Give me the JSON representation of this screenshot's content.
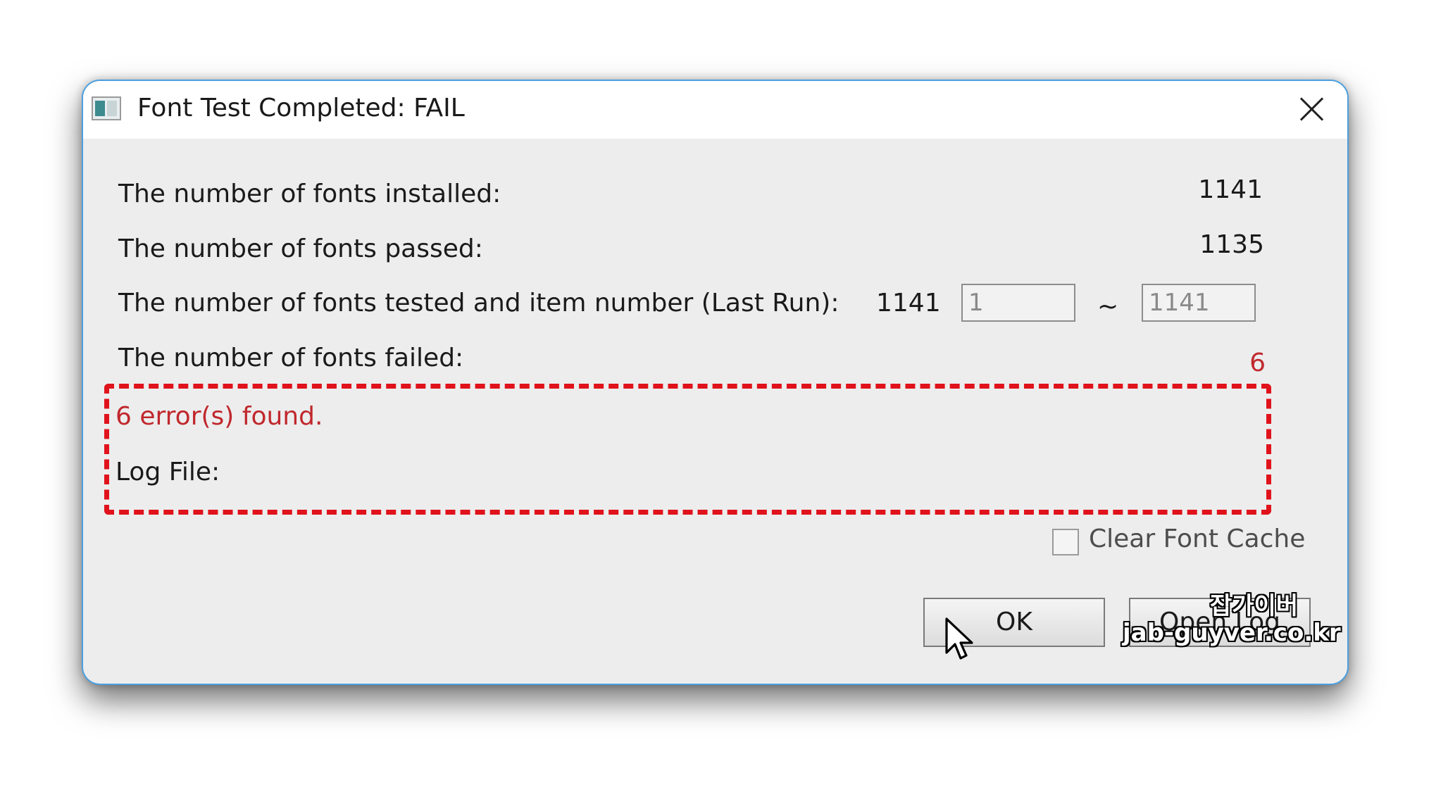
{
  "window": {
    "title": "Font Test Completed: FAIL",
    "icon": "app-window-icon",
    "close_icon": "close-icon"
  },
  "stats": {
    "installed_label": "The number of fonts installed:",
    "installed_value": "1141",
    "passed_label": "The number of fonts passed:",
    "passed_value": "1135",
    "tested_label": "The number of fonts tested and item number (Last Run):",
    "tested_value": "1141",
    "range_from": "1",
    "range_separator": "~",
    "range_to": "1141",
    "failed_label": "The number of fonts failed:",
    "failed_value": "6"
  },
  "errors": {
    "message": "6 error(s) found.",
    "log_file_label": "Log File:"
  },
  "options": {
    "clear_cache_label": "Clear Font Cache",
    "clear_cache_checked": false
  },
  "buttons": {
    "ok_label": "OK",
    "open_log_label": "Open Log"
  },
  "watermark": {
    "korean": "잡가이버",
    "site": "jab-guyver.co.kr"
  },
  "colors": {
    "error_red": "#c0282d",
    "highlight_dash": "#e0121b",
    "window_border": "#4a9fe0"
  }
}
